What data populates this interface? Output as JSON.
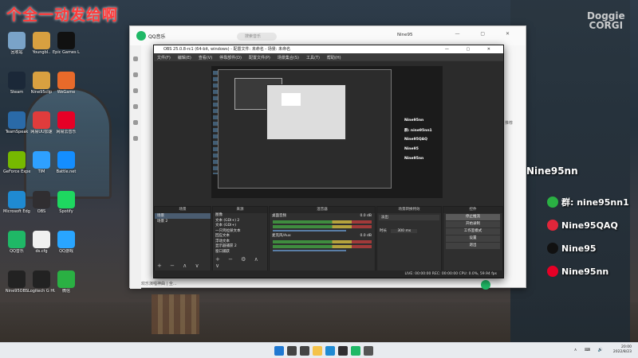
{
  "overlay": {
    "title_text": "个全一动发给啊",
    "logo_line1": "Doggie",
    "logo_line2": "CORGI",
    "stream_name": "Nine95nn",
    "social": [
      {
        "icon": "wechat-icon",
        "color": "#2ab043",
        "text": "群: nine95nn1"
      },
      {
        "icon": "weibo-icon",
        "color": "#e0263a",
        "text": "Nine95QAQ"
      },
      {
        "icon": "tiktok-icon",
        "color": "#111111",
        "text": "Nine95"
      },
      {
        "icon": "netease-music-icon",
        "color": "#e60026",
        "text": "Nine95nn"
      }
    ]
  },
  "desktop_icons": [
    {
      "label": "回收站",
      "color": "#7aa3c8"
    },
    {
      "label": "Steam",
      "color": "#1b2838"
    },
    {
      "label": "TeamSpeak",
      "color": "#2a6aa8"
    },
    {
      "label": "GeForce Experience",
      "color": "#76b900"
    },
    {
      "label": "Microsoft Edge",
      "color": "#1f8ad2"
    },
    {
      "label": "QQ音乐",
      "color": "#1fb866"
    },
    {
      "label": "Nine95OBS",
      "color": "#222222"
    },
    {
      "label": "Youngbl..",
      "color": "#d8a040"
    },
    {
      "label": "Nine95clip",
      "color": "#d8a040"
    },
    {
      "label": "网易UU加速",
      "color": "#e03c3c"
    },
    {
      "label": "TIM",
      "color": "#2ea0ff"
    },
    {
      "label": "OBS",
      "color": "#302e31"
    },
    {
      "label": "ds.cfg",
      "color": "#f0f0f0"
    },
    {
      "label": "Logitech G HUB",
      "color": "#222222"
    },
    {
      "label": "Epic Games Launcher",
      "color": "#111111"
    },
    {
      "label": "WeGame",
      "color": "#e86a2a"
    },
    {
      "label": "网易云音乐",
      "color": "#e60026"
    },
    {
      "label": "Battle.net",
      "color": "#148eff"
    },
    {
      "label": "Spotify",
      "color": "#1ed760"
    },
    {
      "label": "QQ游戏",
      "color": "#29a5ff"
    },
    {
      "label": "微信",
      "color": "#2ab043"
    }
  ],
  "qq_music": {
    "app_name": "QQ音乐",
    "search_placeholder": "搜索音乐",
    "user": "Nine95",
    "right_text": "推荐",
    "footer": "欢乐演唱神曲 | 全..."
  },
  "obs": {
    "title": "OBS 25.0.8-rc1 (64-bit, windows) - 配置文件: 未命名 - 场景: 未命名",
    "menu": [
      "文件(F)",
      "编辑(E)",
      "查看(V)",
      "停靠部件(D)",
      "配置文件(P)",
      "场景集合(S)",
      "工具(T)",
      "帮助(H)"
    ],
    "preview_side": [
      "Nine95nn",
      "群: nine95nn1",
      "Nine95QAQ",
      "Nine95",
      "Nine95nn"
    ],
    "scenes_header": "场景",
    "scenes": [
      "场景",
      "场景 2"
    ],
    "sources_header": "来源",
    "sources": [
      "图像",
      "文本 (GDI+) 2",
      "文本 (GDI+)",
      "一只鸡拉屎文本",
      "回应文本",
      "浮动文本",
      "显示器捕获 2",
      "窗口捕获"
    ],
    "mixer_header": "混音器",
    "mixer": [
      {
        "name": "桌面音频",
        "db": "0.0 dB"
      },
      {
        "name": "麦克风/Aux",
        "db": "0.0 dB"
      }
    ],
    "transitions_header": "场景转换特效",
    "transition_value": "淡出",
    "duration_label": "时长",
    "duration_value": "300 ms",
    "controls_header": "控件",
    "controls": [
      "停止推流",
      "开始录制",
      "工作室模式",
      "设置",
      "退出"
    ],
    "status": "LIVE: 00:00:00    REC: 00:00:00    CPU: 0.0%, 59.94 fps"
  },
  "taskbar": {
    "time": "20:00",
    "date": "2022/8/23",
    "apps": [
      {
        "icon": "windows-start-icon",
        "color": "#1f78d1"
      },
      {
        "icon": "search-icon",
        "color": "#444444"
      },
      {
        "icon": "task-view-icon",
        "color": "#444444"
      },
      {
        "icon": "file-explorer-icon",
        "color": "#f4c24a"
      },
      {
        "icon": "edge-icon",
        "color": "#1f8ad2"
      },
      {
        "icon": "obs-icon",
        "color": "#302e31"
      },
      {
        "icon": "qq-music-icon",
        "color": "#1fb866"
      },
      {
        "icon": "terminal-icon",
        "color": "#555555"
      }
    ]
  }
}
